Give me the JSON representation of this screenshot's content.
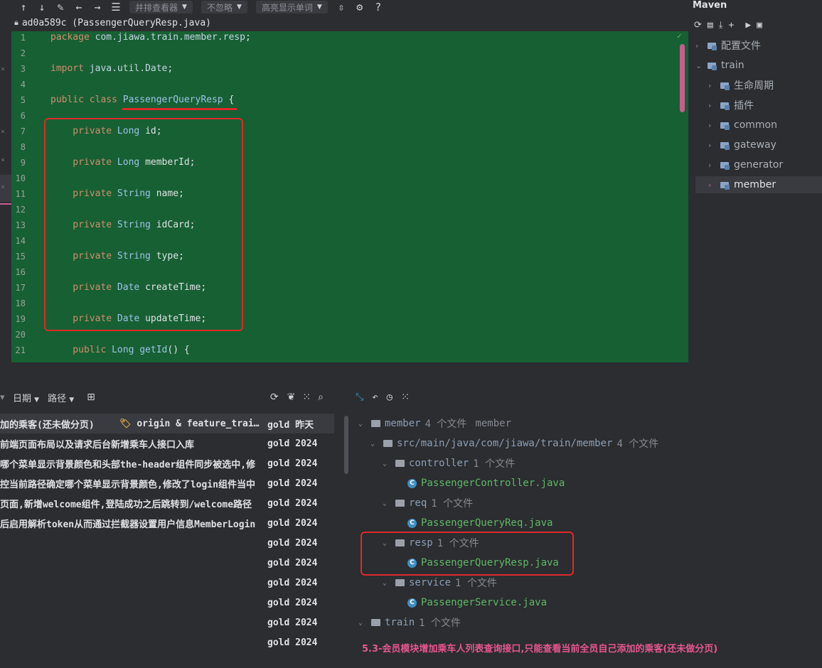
{
  "toolbar": {
    "up_icon": "arrow-up-icon",
    "down_icon": "arrow-down-icon",
    "edit_icon": "pencil-icon",
    "back_icon": "arrow-left-icon",
    "forward_icon": "arrow-right-icon",
    "list_icon": "list-icon",
    "viewer_label": "并排查看器",
    "ignore_label": "不忽略",
    "highlight_label": "高亮显示单词",
    "collapse_icon": "collapse-icon",
    "settings_icon": "gear-icon",
    "help_label": "?"
  },
  "editor": {
    "file_title": "ad0a589c (PassengerQueryResp.java)",
    "lines": [
      {
        "n": "1",
        "parts": [
          {
            "t": "package ",
            "c": "kw"
          },
          {
            "t": "com.jiawa.train.member.resp",
            "c": "pk"
          },
          {
            "t": ";",
            "c": ""
          }
        ]
      },
      {
        "n": "2",
        "parts": []
      },
      {
        "n": "3",
        "parts": [
          {
            "t": "import ",
            "c": "kw"
          },
          {
            "t": "java.util.Date",
            "c": "pk"
          },
          {
            "t": ";",
            "c": ""
          }
        ]
      },
      {
        "n": "4",
        "parts": []
      },
      {
        "n": "5",
        "parts": [
          {
            "t": "public class ",
            "c": "kw"
          },
          {
            "t": "PassengerQueryResp",
            "c": "ty"
          },
          {
            "t": " {",
            "c": ""
          }
        ]
      },
      {
        "n": "6",
        "parts": []
      },
      {
        "n": "7",
        "parts": [
          {
            "t": "    private ",
            "c": "kw"
          },
          {
            "t": "Long ",
            "c": "ty"
          },
          {
            "t": "id;",
            "c": ""
          }
        ]
      },
      {
        "n": "8",
        "parts": []
      },
      {
        "n": "9",
        "parts": [
          {
            "t": "    private ",
            "c": "kw"
          },
          {
            "t": "Long ",
            "c": "ty"
          },
          {
            "t": "memberId;",
            "c": ""
          }
        ]
      },
      {
        "n": "10",
        "parts": []
      },
      {
        "n": "11",
        "parts": [
          {
            "t": "    private ",
            "c": "kw"
          },
          {
            "t": "String ",
            "c": "ty"
          },
          {
            "t": "name;",
            "c": ""
          }
        ]
      },
      {
        "n": "12",
        "parts": []
      },
      {
        "n": "13",
        "parts": [
          {
            "t": "    private ",
            "c": "kw"
          },
          {
            "t": "String ",
            "c": "ty"
          },
          {
            "t": "idCard;",
            "c": ""
          }
        ]
      },
      {
        "n": "14",
        "parts": []
      },
      {
        "n": "15",
        "parts": [
          {
            "t": "    private ",
            "c": "kw"
          },
          {
            "t": "String ",
            "c": "ty"
          },
          {
            "t": "type;",
            "c": ""
          }
        ]
      },
      {
        "n": "16",
        "parts": []
      },
      {
        "n": "17",
        "parts": [
          {
            "t": "    private ",
            "c": "kw"
          },
          {
            "t": "Date ",
            "c": "ty"
          },
          {
            "t": "createTime;",
            "c": ""
          }
        ]
      },
      {
        "n": "18",
        "parts": []
      },
      {
        "n": "19",
        "parts": [
          {
            "t": "    private ",
            "c": "kw"
          },
          {
            "t": "Date ",
            "c": "ty"
          },
          {
            "t": "updateTime;",
            "c": ""
          }
        ]
      },
      {
        "n": "20",
        "parts": []
      },
      {
        "n": "21",
        "parts": [
          {
            "t": "    public ",
            "c": "kw"
          },
          {
            "t": "Long ",
            "c": "ty"
          },
          {
            "t": "getId",
            "c": "ty"
          },
          {
            "t": "() {",
            "c": ""
          }
        ]
      }
    ]
  },
  "maven": {
    "title": "Maven",
    "toolbar_icons": [
      "refresh-icon",
      "add-folder-icon",
      "download-icon",
      "plus-icon",
      "run-icon",
      "console-icon"
    ],
    "items": [
      {
        "label": "配置文件",
        "indent": 0,
        "expanded": false
      },
      {
        "label": "train",
        "indent": 0,
        "expanded": true
      },
      {
        "label": "生命周期",
        "indent": 1,
        "expanded": false
      },
      {
        "label": "插件",
        "indent": 1,
        "expanded": false
      },
      {
        "label": "common",
        "indent": 1,
        "expanded": false
      },
      {
        "label": "gateway",
        "indent": 1,
        "expanded": false
      },
      {
        "label": "generator",
        "indent": 1,
        "expanded": false
      },
      {
        "label": "member",
        "indent": 1,
        "expanded": false,
        "selected": true
      }
    ]
  },
  "log": {
    "date_filter": "日期",
    "path_filter": "路径",
    "rows": [
      {
        "msg": "加的乘客(还未做分页)",
        "tag": "origin & feature_trai…",
        "author": "gold",
        "date": "昨天"
      },
      {
        "msg": "前端页面布局以及请求后台新增乘车人接口入库",
        "author": "gold",
        "date": "2024"
      },
      {
        "msg": "哪个菜单显示背景颜色和头部the-header组件同步被选中,修",
        "author": "gold",
        "date": "2024"
      },
      {
        "msg": "控当前路径确定哪个菜单显示背景颜色,修改了login组件当中",
        "author": "gold",
        "date": "2024"
      },
      {
        "msg": "页面,新增welcome组件,登陆成功之后跳转到/welcome路径",
        "author": "gold",
        "date": "2024"
      },
      {
        "msg": "后启用解析token从而通过拦截器设置用户信息MemberLogin",
        "author": "gold",
        "date": "2024"
      },
      {
        "msg": "",
        "author": "gold",
        "date": "2024"
      },
      {
        "msg": "",
        "author": "gold",
        "date": "2024"
      },
      {
        "msg": "",
        "author": "gold",
        "date": "2024"
      },
      {
        "msg": "",
        "author": "gold",
        "date": "2024"
      },
      {
        "msg": "",
        "author": "gold",
        "date": "2024"
      },
      {
        "msg": "",
        "author": "gold",
        "date": "2024"
      }
    ]
  },
  "changes": {
    "tree": [
      {
        "kind": "folder",
        "name": "member",
        "count": "4 个文件",
        "extra": "member",
        "indent": 0
      },
      {
        "kind": "folder",
        "name": "src/main/java/com/jiawa/train/member",
        "count": "4 个文件",
        "indent": 1
      },
      {
        "kind": "folder",
        "name": "controller",
        "count": "1 个文件",
        "indent": 2
      },
      {
        "kind": "file",
        "name": "PassengerController.java",
        "indent": 3
      },
      {
        "kind": "folder",
        "name": "req",
        "count": "1 个文件",
        "indent": 2
      },
      {
        "kind": "file",
        "name": "PassengerQueryReq.java",
        "indent": 3
      },
      {
        "kind": "folder",
        "name": "resp",
        "count": "1 个文件",
        "indent": 2
      },
      {
        "kind": "file",
        "name": "PassengerQueryResp.java",
        "indent": 3
      },
      {
        "kind": "folder",
        "name": "service",
        "count": "1 个文件",
        "indent": 2
      },
      {
        "kind": "file",
        "name": "PassengerService.java",
        "indent": 3
      },
      {
        "kind": "folder",
        "name": "train",
        "count": "1 个文件",
        "indent": 0
      }
    ],
    "commit_message": "5.3-会员模块增加乘车人列表查询接口,只能查看当前全员自己添加的乘客(还未做分页)"
  },
  "colors": {
    "added_bg": "#176033",
    "highlight_red": "#e0282b",
    "commit_msg": "#e7568f"
  }
}
